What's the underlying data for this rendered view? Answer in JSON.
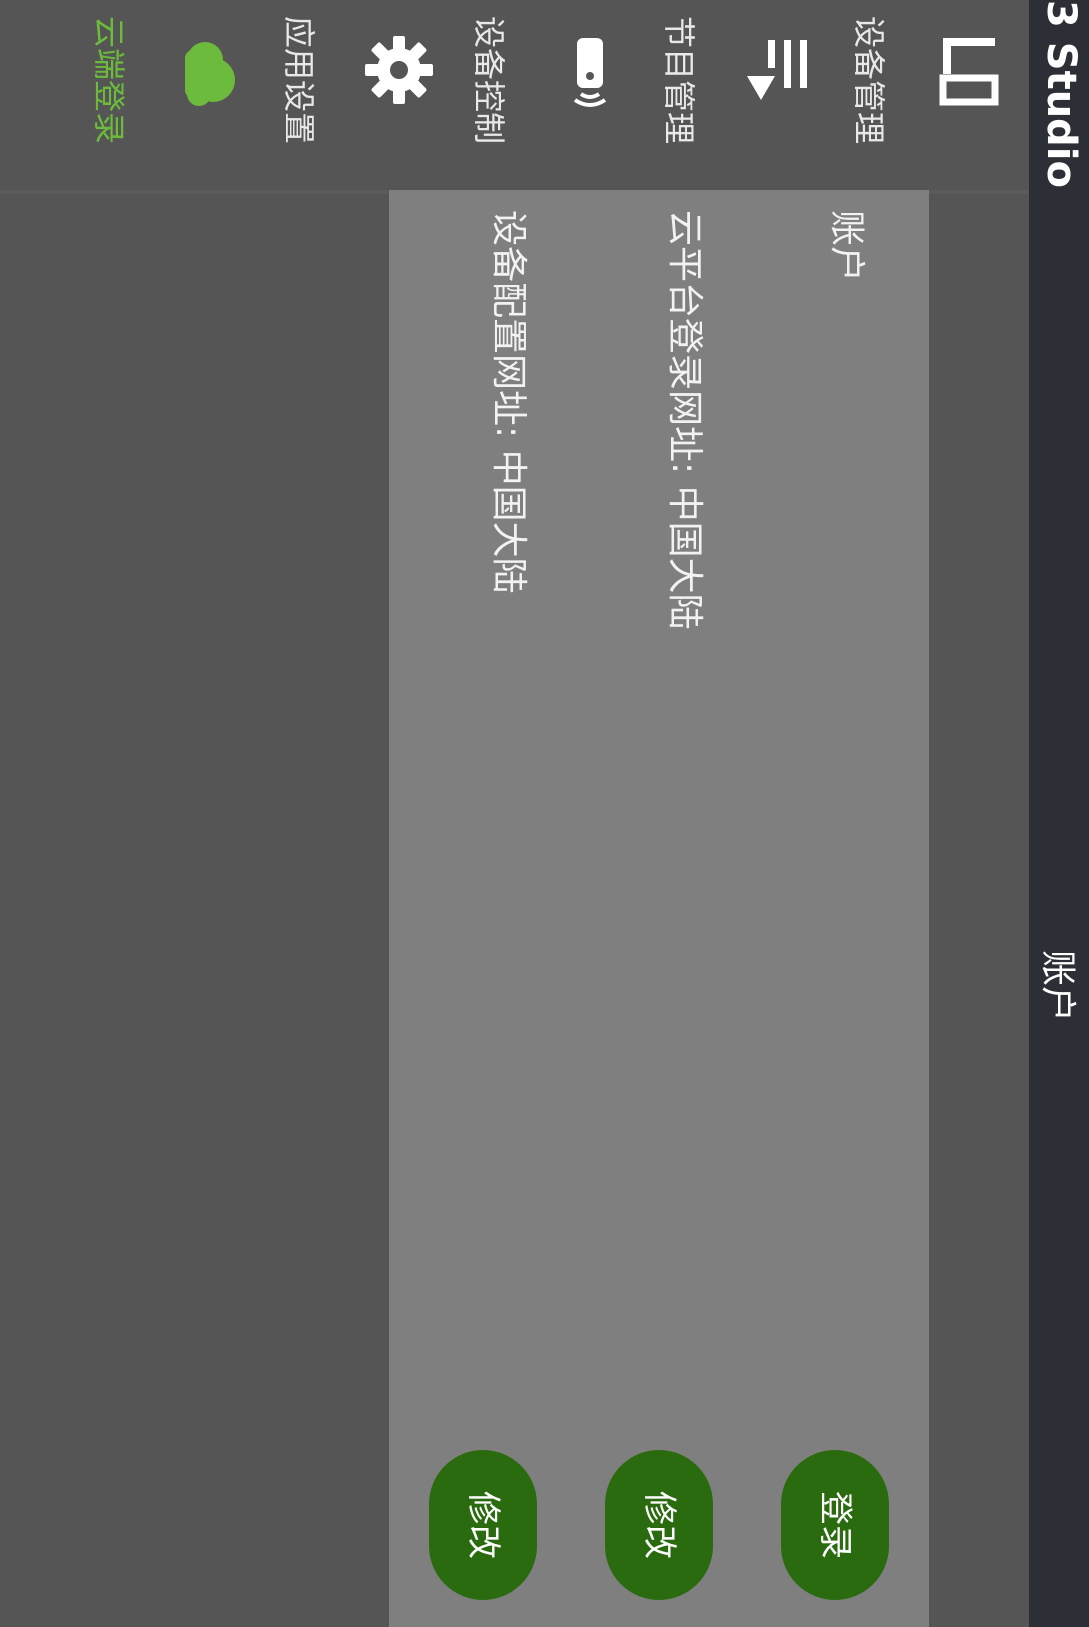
{
  "app": {
    "title": "3 Studio"
  },
  "header": {
    "title": "账户"
  },
  "sidebar": {
    "items": [
      {
        "label": "设备管理",
        "icon": "device-management-icon",
        "active": false
      },
      {
        "label": "节目管理",
        "icon": "playlist-icon",
        "active": false
      },
      {
        "label": "设备控制",
        "icon": "remote-control-icon",
        "active": false
      },
      {
        "label": "应用设置",
        "icon": "gear-icon",
        "active": false
      },
      {
        "label": "云端登录",
        "icon": "cloud-icon",
        "active": true
      }
    ]
  },
  "panel": {
    "account_label": "账户",
    "cloud_url_label": "云平台登录网址: 中国大陆",
    "device_url_label": "设备配置网址: 中国大陆",
    "login_button": "登录",
    "modify_cloud_button": "修改",
    "modify_device_button": "修改"
  },
  "colors": {
    "topbar": "#2d2f37",
    "sidebar": "#555555",
    "panel": "#7f7f7f",
    "accent_green": "#6cbb3c",
    "button_green": "#2a6b0f"
  }
}
